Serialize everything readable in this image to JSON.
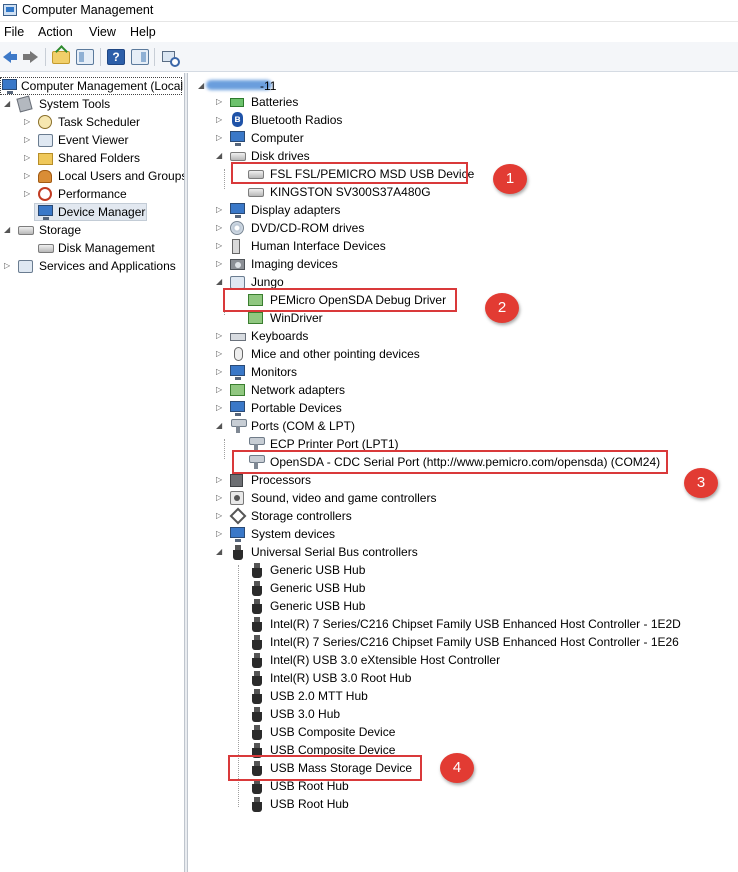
{
  "window": {
    "title": "Computer Management"
  },
  "menu": [
    "File",
    "Action",
    "View",
    "Help"
  ],
  "toolbar": {
    "buttons": [
      "back-icon",
      "forward-icon",
      "up-one-level-icon",
      "show-hide-console-tree-icon",
      "help-icon",
      "properties-icon",
      "scan-hardware-icon"
    ],
    "help_glyph": "?"
  },
  "left_tree": {
    "root": "Computer Management (Local",
    "system_tools": "System Tools",
    "task_scheduler": "Task Scheduler",
    "event_viewer": "Event Viewer",
    "shared_folders": "Shared Folders",
    "local_users": "Local Users and Groups",
    "performance": "Performance",
    "device_manager": "Device Manager",
    "storage": "Storage",
    "disk_management": "Disk Management",
    "services": "Services and Applications"
  },
  "device_tree": {
    "host_suffix": "-11",
    "batteries": "Batteries",
    "bluetooth": "Bluetooth Radios",
    "computer": "Computer",
    "disk_drives": "Disk drives",
    "disk_1": "FSL FSL/PEMICRO MSD USB Device",
    "disk_2": "KINGSTON SV300S37A480G",
    "display": "Display adapters",
    "dvd": "DVD/CD-ROM drives",
    "hid": "Human Interface Devices",
    "imaging": "Imaging devices",
    "jungo": "Jungo",
    "jungo_1": "PEMicro OpenSDA Debug Driver",
    "jungo_2": "WinDriver",
    "keyboards": "Keyboards",
    "mice": "Mice and other pointing devices",
    "monitors": "Monitors",
    "network": "Network adapters",
    "portable": "Portable Devices",
    "ports": "Ports (COM & LPT)",
    "port_1": "ECP Printer Port (LPT1)",
    "port_2": "OpenSDA - CDC Serial Port (http://www.pemicro.com/opensda) (COM24)",
    "processors": "Processors",
    "sound": "Sound, video and game controllers",
    "storage_ctrl": "Storage controllers",
    "system_devices": "System devices",
    "usb": "Universal Serial Bus controllers",
    "usb_items": [
      "Generic USB Hub",
      "Generic USB Hub",
      "Generic USB Hub",
      "Intel(R) 7 Series/C216 Chipset Family USB Enhanced Host Controller - 1E2D",
      "Intel(R) 7 Series/C216 Chipset Family USB Enhanced Host Controller - 1E26",
      "Intel(R) USB 3.0 eXtensible Host Controller",
      "Intel(R) USB 3.0 Root Hub",
      "USB 2.0 MTT Hub",
      "USB 3.0 Hub",
      "USB Composite Device",
      "USB Composite Device",
      "USB Mass Storage Device",
      "USB Root Hub",
      "USB Root Hub"
    ]
  },
  "callouts": [
    "1",
    "2",
    "3",
    "4"
  ],
  "colors": {
    "highlight_red": "#d9393a",
    "badge_red": "#e23b33"
  }
}
